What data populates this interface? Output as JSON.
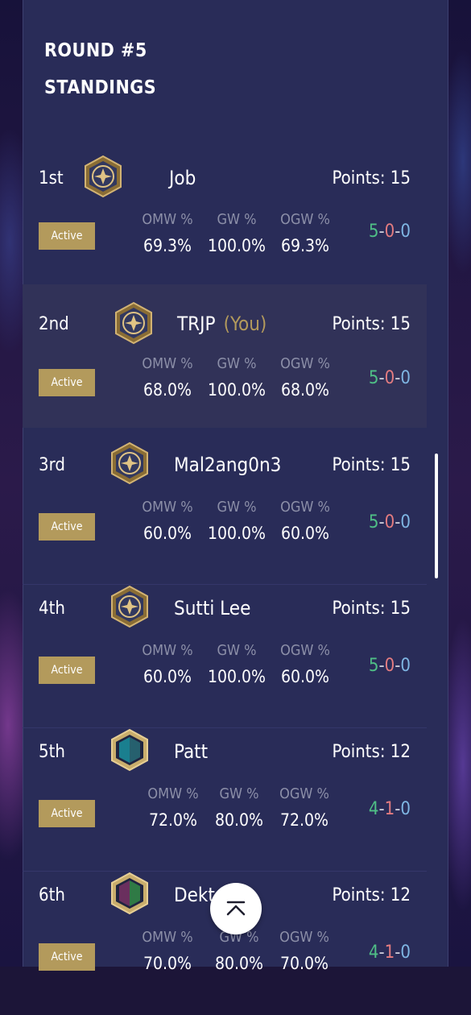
{
  "header": {
    "round": "ROUND #5",
    "subtitle": "STANDINGS"
  },
  "standings": [
    {
      "rank": "1st",
      "name": "Job",
      "you_tag": "",
      "points": "Points: 15",
      "status": "Active",
      "omw_label": "OMW %",
      "omw": "69.3%",
      "gw_label": "GW %",
      "gw": "100.0%",
      "ogw_label": "OGW %",
      "ogw": "69.3%",
      "wins": "5",
      "losses": "0",
      "draws": "0",
      "emblem": "gold-star-emblem-icon"
    },
    {
      "rank": "2nd",
      "name": "TRJP",
      "you_tag": "(You)",
      "points": "Points: 15",
      "status": "Active",
      "omw_label": "OMW %",
      "omw": "68.0%",
      "gw_label": "GW %",
      "gw": "100.0%",
      "ogw_label": "OGW %",
      "ogw": "68.0%",
      "wins": "5",
      "losses": "0",
      "draws": "0",
      "emblem": "gold-star-emblem-icon"
    },
    {
      "rank": "3rd",
      "name": "Mal2ang0n3",
      "you_tag": "",
      "points": "Points: 15",
      "status": "Active",
      "omw_label": "OMW %",
      "omw": "60.0%",
      "gw_label": "GW %",
      "gw": "100.0%",
      "ogw_label": "OGW %",
      "ogw": "60.0%",
      "wins": "5",
      "losses": "0",
      "draws": "0",
      "emblem": "gold-star-emblem-icon"
    },
    {
      "rank": "4th",
      "name": "Sutti Lee",
      "you_tag": "",
      "points": "Points: 15",
      "status": "Active",
      "omw_label": "OMW %",
      "omw": "60.0%",
      "gw_label": "GW %",
      "gw": "100.0%",
      "ogw_label": "OGW %",
      "ogw": "60.0%",
      "wins": "5",
      "losses": "0",
      "draws": "0",
      "emblem": "gold-star-emblem-icon"
    },
    {
      "rank": "5th",
      "name": "Patt",
      "you_tag": "",
      "points": "Points: 12",
      "status": "Active",
      "omw_label": "OMW %",
      "omw": "72.0%",
      "gw_label": "GW %",
      "gw": "80.0%",
      "ogw_label": "OGW %",
      "ogw": "72.0%",
      "wins": "4",
      "losses": "1",
      "draws": "0",
      "emblem": "teal-hex-emblem-icon"
    },
    {
      "rank": "6th",
      "name": "Dekt",
      "you_tag": "",
      "points": "Points: 12",
      "status": "Active",
      "omw_label": "OMW %",
      "omw": "70.0%",
      "gw_label": "GW %",
      "gw": "80.0%",
      "ogw_label": "OGW %",
      "ogw": "70.0%",
      "wins": "4",
      "losses": "1",
      "draws": "0",
      "emblem": "green-purple-hex-emblem-icon"
    }
  ],
  "colors": {
    "gold": "#b39a5c",
    "panel": "#292c58",
    "win": "#4fbf86",
    "loss": "#e47c80",
    "draw": "#7fb6e3"
  },
  "scroll_top_icon": "chevron-up-icon"
}
